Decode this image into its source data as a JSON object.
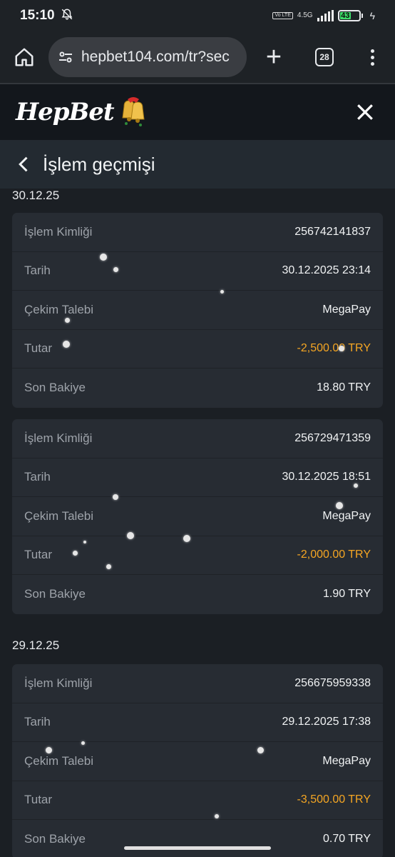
{
  "status_bar": {
    "time": "15:10",
    "volte": "Vo LTE",
    "network": "4.5G",
    "battery": "43"
  },
  "browser": {
    "url": "hepbet104.com/tr?sec",
    "tab_count": "28"
  },
  "site": {
    "logo_text": "HepBet"
  },
  "page": {
    "title": "İşlem geçmişi"
  },
  "labels": {
    "id": "İşlem Kimliği",
    "date": "Tarih",
    "type": "Çekim Talebi",
    "amount": "Tutar",
    "balance": "Son Bakiye"
  },
  "groups": [
    {
      "date": "30.12.25",
      "transactions": [
        {
          "id": "256742141837",
          "datetime": "30.12.2025 23:14",
          "method": "MegaPay",
          "amount": "-2,500.00 TRY",
          "balance": "18.80 TRY"
        },
        {
          "id": "256729471359",
          "datetime": "30.12.2025 18:51",
          "method": "MegaPay",
          "amount": "-2,000.00 TRY",
          "balance": "1.90 TRY"
        }
      ]
    },
    {
      "date": "29.12.25",
      "transactions": [
        {
          "id": "256675959338",
          "datetime": "29.12.2025 17:38",
          "method": "MegaPay",
          "amount": "-3,500.00 TRY",
          "balance": "0.70 TRY"
        }
      ]
    }
  ],
  "colors": {
    "negative_amount": "#f5a623",
    "card_bg": "#272c33",
    "page_bg": "#1b1f24"
  }
}
